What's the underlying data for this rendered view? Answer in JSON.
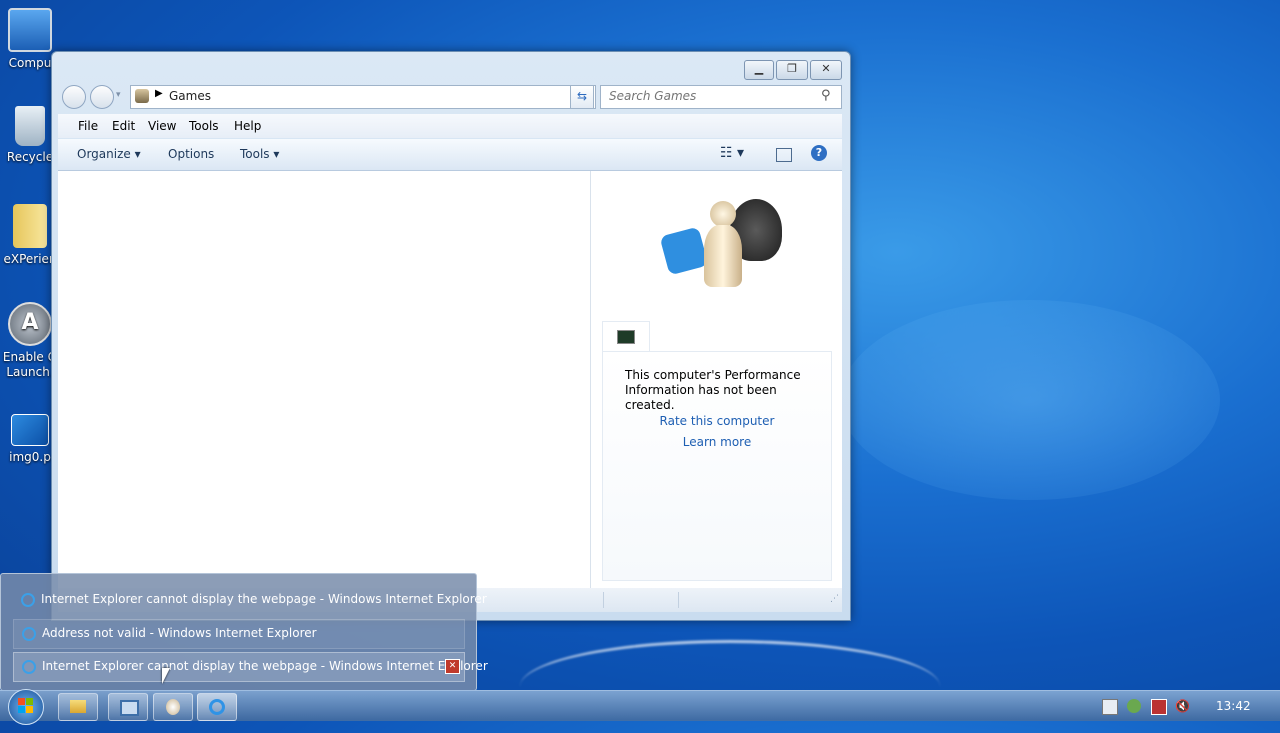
{
  "desktop": {
    "icons": [
      {
        "label": "Compu",
        "name": "computer"
      },
      {
        "label": "Recycle",
        "name": "recycle-bin"
      },
      {
        "label": "eXPerien",
        "name": "folder"
      },
      {
        "label": "Enable Q Launch.",
        "name": "app-launcher"
      },
      {
        "label": "img0.p",
        "name": "image-file"
      }
    ]
  },
  "window": {
    "address": "Games",
    "search_placeholder": "Search Games",
    "menu": [
      "File",
      "Edit",
      "View",
      "Tools",
      "Help"
    ],
    "commands": {
      "organize": "Organize",
      "options": "Options",
      "tools": "Tools"
    },
    "perf": {
      "message": "This computer's Performance Information has not been created.",
      "rate_link": "Rate this computer",
      "learn_link": "Learn more"
    }
  },
  "jumplist": {
    "items": [
      "Internet Explorer cannot display the webpage - Windows Internet Explorer",
      "Address not valid - Windows Internet Explorer",
      "Internet Explorer cannot display the webpage - Windows Internet Explorer"
    ]
  },
  "taskbar": {
    "clock": "13:42"
  },
  "colors": {
    "link": "#1e5fb3",
    "close_red": "#c0392b"
  }
}
